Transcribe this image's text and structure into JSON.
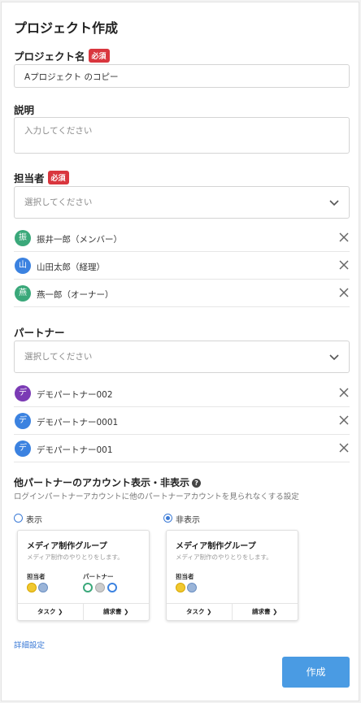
{
  "page": {
    "title": "プロジェクト作成"
  },
  "project_name": {
    "label": "プロジェクト名",
    "required": "必須",
    "value": "Aプロジェクト のコピー"
  },
  "description": {
    "label": "説明",
    "placeholder": "入力してください"
  },
  "assignee": {
    "label": "担当者",
    "required": "必須",
    "placeholder": "選択してください",
    "members": [
      {
        "initial": "振",
        "name": "振井一郎（メンバー）",
        "color": "#3aa87a"
      },
      {
        "initial": "山",
        "name": "山田太郎（経理）",
        "color": "#3b82e0"
      },
      {
        "initial": "燕",
        "name": "燕一郎（オーナー）",
        "color": "#3aa87a"
      }
    ]
  },
  "partner": {
    "label": "パートナー",
    "placeholder": "選択してください",
    "members": [
      {
        "initial": "デ",
        "name": "デモパートナー002",
        "color": "#7b3bb5"
      },
      {
        "initial": "デ",
        "name": "デモパートナー0001",
        "color": "#3b82e0"
      },
      {
        "initial": "デ",
        "name": "デモパートナー001",
        "color": "#3b82e0"
      }
    ]
  },
  "visibility": {
    "title": "他パートナーのアカウント表示・非表示",
    "description": "ログインパートナーアカウントに他のパートナーアカウントを見られなくする設定",
    "options": [
      {
        "label": "表示",
        "selected": false,
        "card": {
          "title": "メディア制作グループ",
          "desc": "メディア制作のやりとりをします。",
          "assignee_label": "担当者",
          "partner_label": "パートナー",
          "task": "タスク ❯",
          "invoice": "請求書 ❯"
        }
      },
      {
        "label": "非表示",
        "selected": true,
        "card": {
          "title": "メディア制作グループ",
          "desc": "メディア制作のやりとりをします。",
          "assignee_label": "担当者",
          "task": "タスク ❯",
          "invoice": "請求書 ❯"
        }
      }
    ]
  },
  "advanced_link": "詳細設定",
  "submit_label": "作成",
  "colors": {
    "accent": "#4a9be3",
    "required": "#d9363e",
    "link": "#3b7ad6"
  }
}
